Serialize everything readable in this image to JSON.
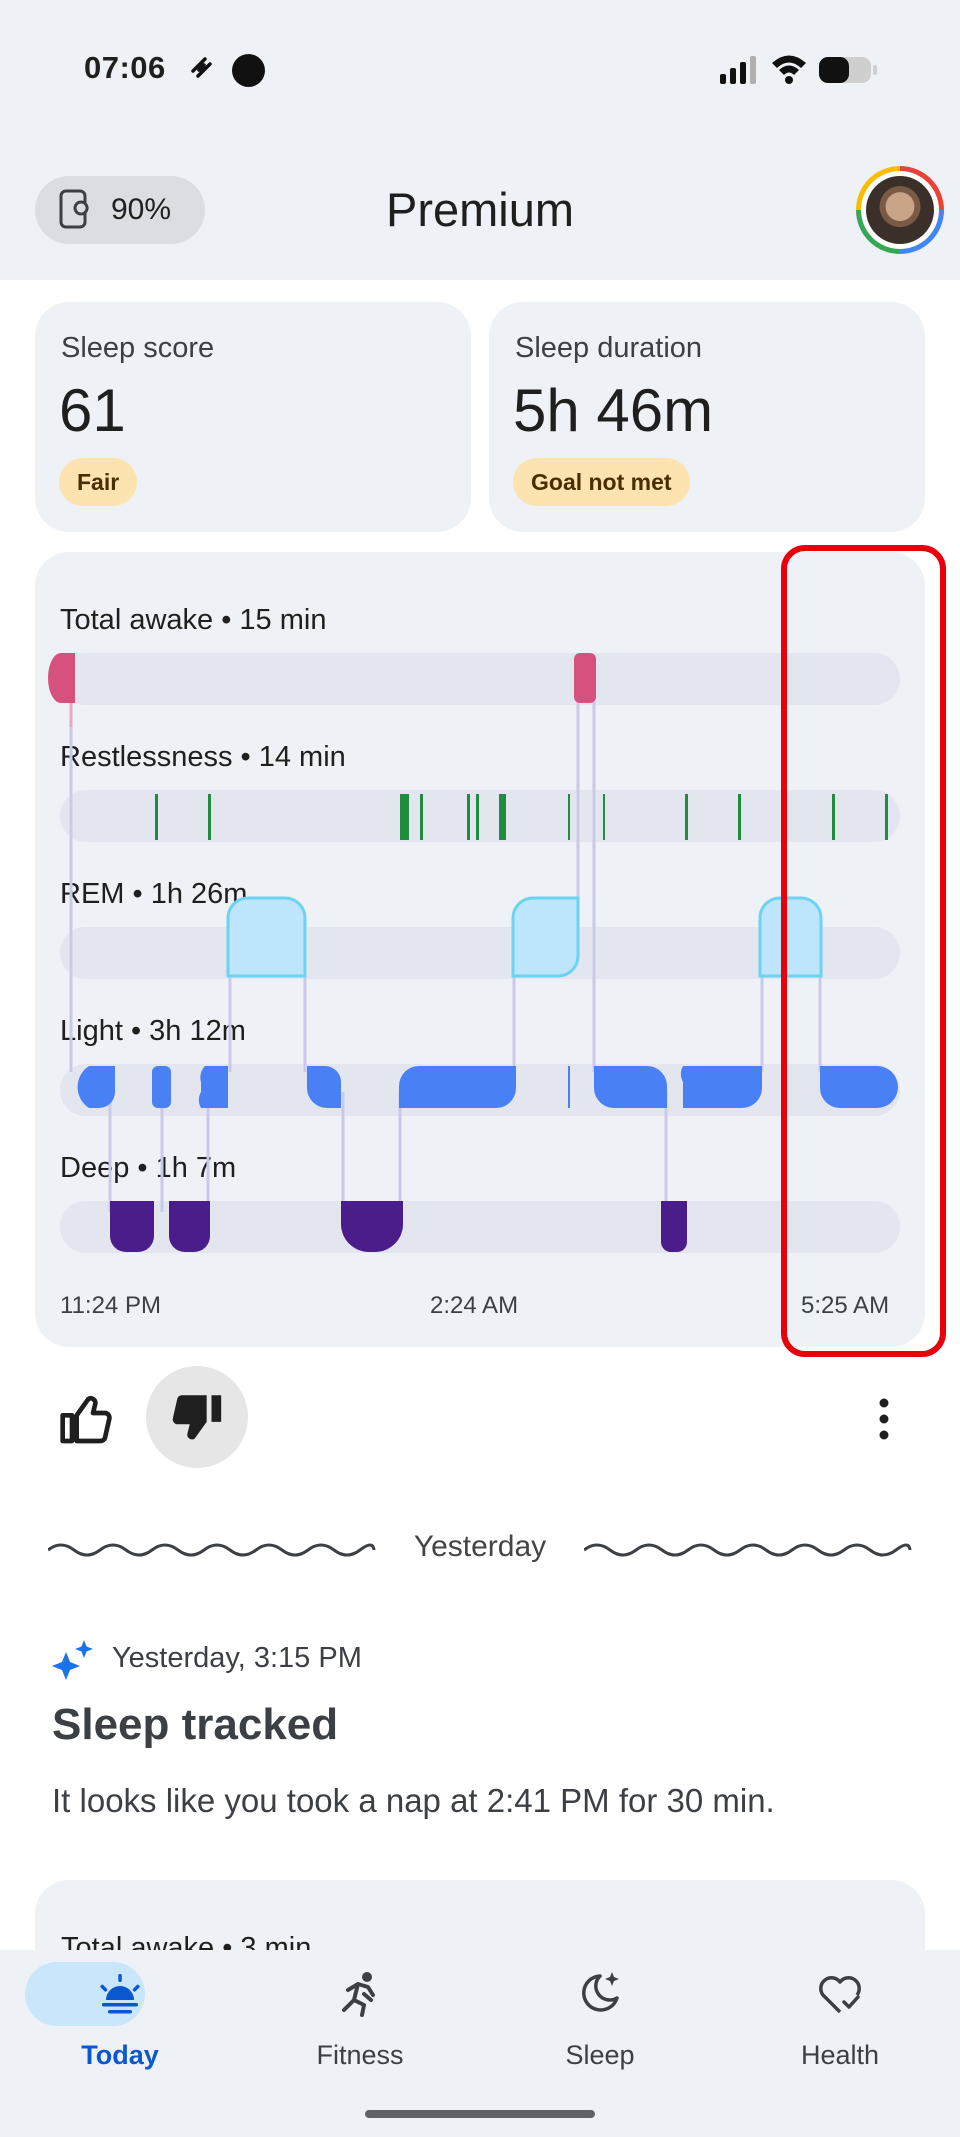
{
  "status_bar": {
    "time": "07:06"
  },
  "header": {
    "battery_percent": "90%",
    "title": "Premium"
  },
  "summary": {
    "score_label": "Sleep score",
    "score_value": "61",
    "score_chip": "Fair",
    "duration_label": "Sleep duration",
    "duration_value": "5h 46m",
    "duration_chip": "Goal not met"
  },
  "hypnogram": {
    "stages": {
      "awake": "Total awake • 15 min",
      "restless": "Restlessness • 14 min",
      "rem": "REM • 1h 26m",
      "light": "Light • 3h 12m",
      "deep": "Deep • 1h 7m"
    },
    "axis": {
      "start": "11:24 PM",
      "mid": "2:24 AM",
      "end": "5:25 AM"
    },
    "colors": {
      "awake": "#d6517d",
      "restless": "#1e8e3e",
      "rem": "#bde5fb",
      "rem_border": "#6cd3f2",
      "light": "#4a80f5",
      "deep": "#4a1d8a",
      "highlight": "#e8000b"
    }
  },
  "feedback": {
    "like_icon": "thumb-up-icon",
    "dislike_icon": "thumb-down-icon"
  },
  "divider": {
    "label": "Yesterday"
  },
  "nap_card": {
    "time": "Yesterday, 3:15 PM",
    "title": "Sleep tracked",
    "body": "It looks like you took a nap at 2:41 PM for 30 min."
  },
  "peek_card": {
    "label": "Total awake • 3 min"
  },
  "nav": {
    "items": [
      {
        "label": "Today",
        "icon": "sunrise-icon",
        "active": true
      },
      {
        "label": "Fitness",
        "icon": "running-icon",
        "active": false
      },
      {
        "label": "Sleep",
        "icon": "moon-icon",
        "active": false
      },
      {
        "label": "Health",
        "icon": "heart-icon",
        "active": false
      }
    ]
  }
}
